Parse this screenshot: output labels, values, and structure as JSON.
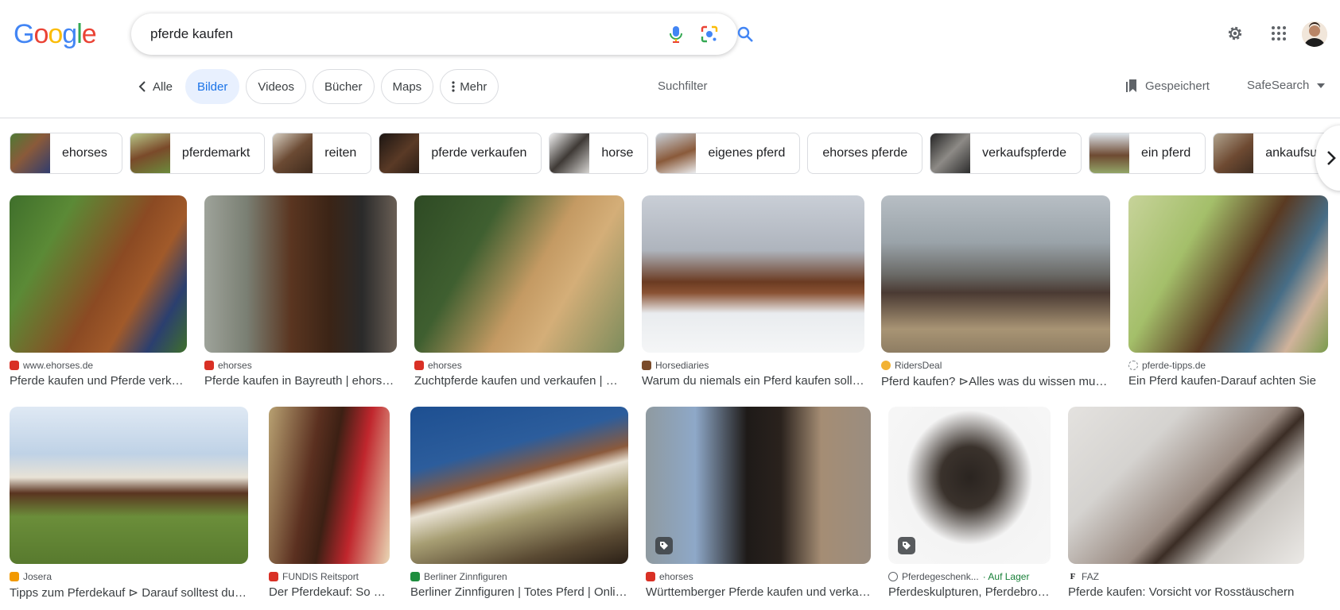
{
  "logo": {
    "letters": [
      "G",
      "o",
      "o",
      "g",
      "l",
      "e"
    ],
    "colors": [
      "#4285F4",
      "#EA4335",
      "#FBBC05",
      "#4285F4",
      "#34A853",
      "#EA4335"
    ]
  },
  "search": {
    "query": "pferde kaufen"
  },
  "header_icons": [
    "mic-icon",
    "lens-icon",
    "search-icon",
    "gear-icon",
    "apps-grid-icon"
  ],
  "tabs": {
    "back_label": "Alle",
    "items": [
      {
        "label": "Bilder",
        "active": true
      },
      {
        "label": "Videos",
        "active": false
      },
      {
        "label": "Bücher",
        "active": false
      },
      {
        "label": "Maps",
        "active": false
      },
      {
        "label": "Mehr",
        "active": false
      }
    ],
    "filter_label": "Suchfilter",
    "saved_label": "Gespeichert",
    "safesearch_label": "SafeSearch"
  },
  "chips": [
    {
      "label": "ehorses",
      "thumb": "#8a5a3a"
    },
    {
      "label": "pferdemarkt",
      "thumb": "#7b8c4c"
    },
    {
      "label": "reiten",
      "thumb": "#6b4a33"
    },
    {
      "label": "pferde verkaufen",
      "thumb": "#3b2a1f"
    },
    {
      "label": "horse",
      "thumb": "#3f3a36"
    },
    {
      "label": "eigenes pferd",
      "thumb": "#c9d3dc"
    },
    {
      "label": "ehorses pferde",
      "thumb": null
    },
    {
      "label": "verkaufspferde",
      "thumb": "#5b5856"
    },
    {
      "label": "ein pferd",
      "thumb": "#94a96a"
    },
    {
      "label": "ankaufsuntersuchung",
      "thumb": "#6e4a32"
    }
  ],
  "results_row1": [
    {
      "source": "www.ehorses.de",
      "favicon": "#d93025",
      "title": "Pferde kaufen und Pferde verkaufen",
      "colors": [
        "#3f6f2b",
        "#8b4a23",
        "#2b3f6f"
      ]
    },
    {
      "source": "ehorses",
      "favicon": "#d93025",
      "title": "Pferde kaufen in Bayreuth | ehorses.de",
      "colors": [
        "#7a7f73",
        "#5a3520",
        "#2a2a2a"
      ]
    },
    {
      "source": "ehorses",
      "favicon": "#d93025",
      "title": "Zuchtpferde kaufen und verkaufen | ehorses.de",
      "colors": [
        "#3f5f30",
        "#c49a63",
        "#7d8c5c"
      ]
    },
    {
      "source": "Horsediaries",
      "favicon": "#7a4b2a",
      "title": "Warum du niemals ein Pferd kaufen solltest",
      "colors": [
        "#c9ced6",
        "#6b3b22",
        "#e9ecef"
      ]
    },
    {
      "source": "RidersDeal",
      "favicon": "#f2b233",
      "title": "Pferd kaufen? ⊳Alles was du wissen musst",
      "colors": [
        "#b7bec4",
        "#6b6b68",
        "#a89474"
      ]
    },
    {
      "source": "pferde-tipps.de",
      "favicon": "#80868b",
      "title": "Ein Pferd kaufen-Darauf achten Sie",
      "colors": [
        "#a4bf6a",
        "#5a3a22",
        "#476d86"
      ]
    }
  ],
  "results_row2": [
    {
      "source": "Josera",
      "favicon": "#f29900",
      "title": "Tipps zum Pferdekauf ⊳ Darauf solltest du achten",
      "colors": [
        "#bfd2e6",
        "#6b8e3a",
        "#5a3420"
      ],
      "badge": false
    },
    {
      "source": "FUNDIS Reitsport",
      "favicon": "#d93025",
      "title": "Der Pferdekauf: So klappt es",
      "colors": [
        "#b8a172",
        "#5b3020",
        "#c0262d"
      ],
      "badge": false
    },
    {
      "source": "Berliner Zinnfiguren",
      "favicon": "#1e8e3e",
      "title": "Berliner Zinnfiguren | Totes Pferd | Online kaufen",
      "colors": [
        "#2c5d9c",
        "#8b5a3c",
        "#a79e73"
      ],
      "badge": false
    },
    {
      "source": "ehorses",
      "favicon": "#d93025",
      "title": "Württemberger Pferde kaufen und verkaufen",
      "colors": [
        "#8ea8c8",
        "#1e1a18",
        "#a58d74"
      ],
      "badge": true
    },
    {
      "source": "Pferdegeschenk...",
      "favicon": "#5f6368",
      "availability": "· Auf Lager",
      "title": "Pferdeskulpturen, Pferdebronzen kaufen",
      "colors": [
        "#f4f4f4",
        "#2a2420",
        "#d6d3cf"
      ],
      "badge": true
    },
    {
      "source": "FAZ",
      "favicon": "#202124",
      "title": "Pferde kaufen: Vorsicht vor Rosstäuschern",
      "colors": [
        "#d5d3d0",
        "#9a8b82",
        "#3b2d25"
      ],
      "badge": false
    }
  ]
}
